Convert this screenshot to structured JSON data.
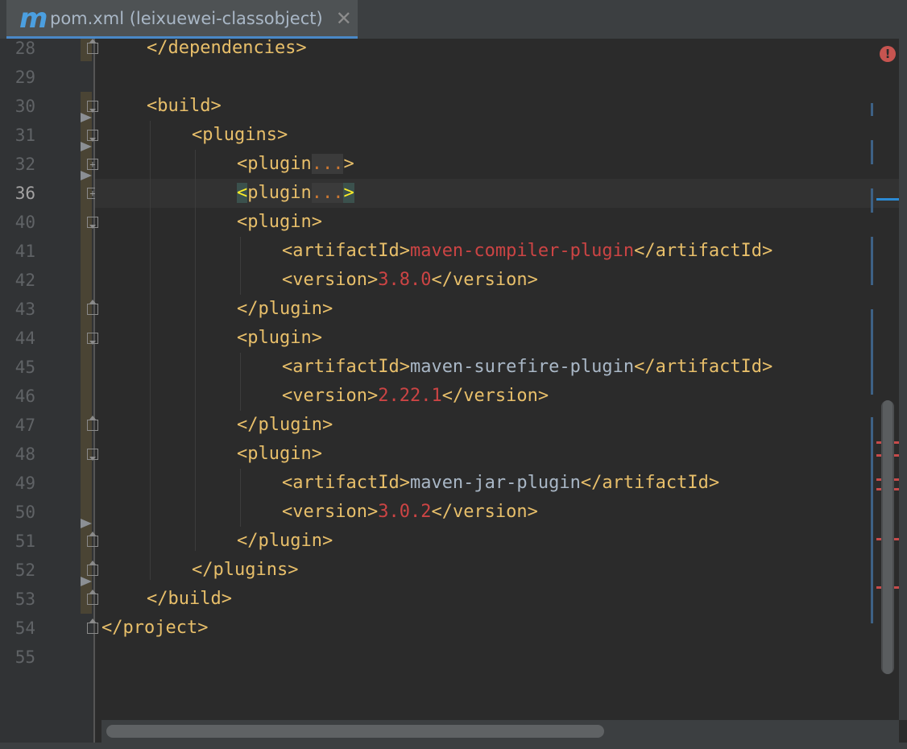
{
  "tab": {
    "icon_glyph": "m",
    "title": "pom.xml (leixuewei-classobject)",
    "close_glyph": "✕"
  },
  "gutter": {
    "line_numbers": [
      "28",
      "29",
      "30",
      "31",
      "32",
      "36",
      "40",
      "41",
      "42",
      "43",
      "44",
      "45",
      "46",
      "47",
      "48",
      "49",
      "50",
      "51",
      "52",
      "53",
      "54",
      "55"
    ],
    "current_line": "36"
  },
  "code": {
    "l28": "</dependencies>",
    "l30": "<build>",
    "l31": "<plugins>",
    "l32_open": "<plugin",
    "l32_dots": "...",
    "l32_close": ">",
    "l36_lt": "<",
    "l36_tag": "plugin",
    "l36_dots": "...",
    "l36_gt": ">",
    "l40": "<plugin>",
    "l41_open": "<artifactId>",
    "l41_val": "maven-compiler-plugin",
    "l41_close": "</artifactId>",
    "l42_open": "<version>",
    "l42_val": "3.8.0",
    "l42_close": "</version>",
    "l43": "</plugin>",
    "l44": "<plugin>",
    "l45_open": "<artifactId>",
    "l45_val": "maven-surefire-plugin",
    "l45_close": "</artifactId>",
    "l46_open": "<version>",
    "l46_val": "2.22.1",
    "l46_close": "</version>",
    "l47": "</plugin>",
    "l48": "<plugin>",
    "l49_open": "<artifactId>",
    "l49_val": "maven-jar-plugin",
    "l49_close": "</artifactId>",
    "l50_open": "<version>",
    "l50_val": "3.0.2",
    "l50_close": "</version>",
    "l51": "</plugin>",
    "l52": "</plugins>",
    "l53": "</build>",
    "l54": "</project>"
  },
  "status": {
    "error_glyph": "!"
  },
  "colors": {
    "tag": "#e8bf6a",
    "text_value": "#a9b7c6",
    "number_value": "#cc4444",
    "background": "#2b2b2b"
  }
}
